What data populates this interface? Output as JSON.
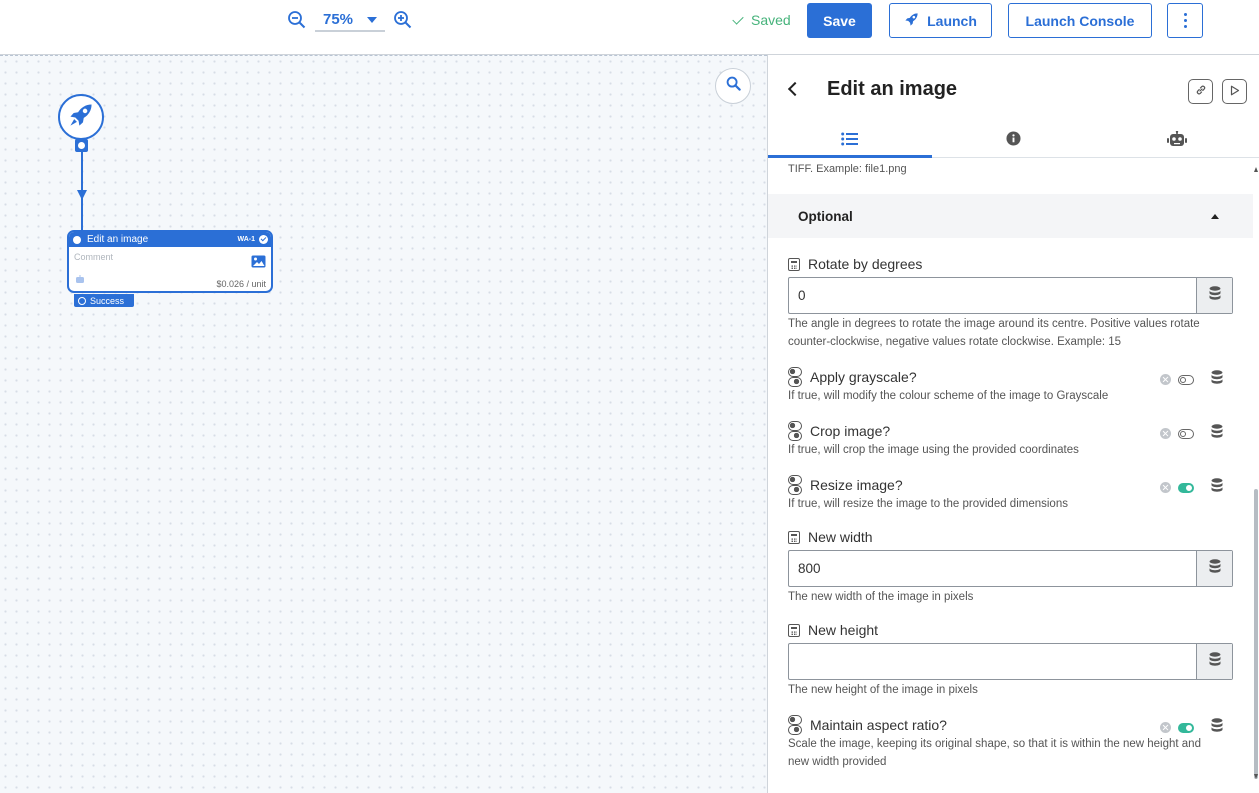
{
  "toolbar": {
    "zoom_value": "75%",
    "saved_label": "Saved",
    "save_label": "Save",
    "launch_label": "Launch",
    "launch_console_label": "Launch Console"
  },
  "canvas": {
    "task_node": {
      "title": "Edit an image",
      "id": "WA-1",
      "comment_placeholder": "Comment",
      "cost": "$0.026 / unit",
      "status": "Success"
    }
  },
  "panel": {
    "title": "Edit an image",
    "tabs": [
      {
        "icon": "list-icon",
        "active": true
      },
      {
        "icon": "info-icon",
        "active": false
      },
      {
        "icon": "robot-icon",
        "active": false
      }
    ],
    "previous_help_tail": "TIFF. Example: file1.png",
    "optional_label": "Optional",
    "fields": {
      "rotate": {
        "label": "Rotate by degrees",
        "value": "0",
        "help": "The angle in degrees to rotate the image around its centre. Positive values rotate counter-clockwise, negative values rotate clockwise. Example: 15"
      },
      "grayscale": {
        "label": "Apply grayscale?",
        "enabled": false,
        "help": "If true, will modify the colour scheme of the image to Grayscale"
      },
      "crop": {
        "label": "Crop image?",
        "enabled": false,
        "help": "If true, will crop the image using the provided coordinates"
      },
      "resize": {
        "label": "Resize image?",
        "enabled": true,
        "help": "If true, will resize the image to the provided dimensions"
      },
      "new_width": {
        "label": "New width",
        "value": "800",
        "help": "The new width of the image in pixels"
      },
      "new_height": {
        "label": "New height",
        "value": "",
        "help": "The new height of the image in pixels"
      },
      "aspect": {
        "label": "Maintain aspect ratio?",
        "enabled": true,
        "help": "Scale the image, keeping its original shape, so that it is within the new height and new width provided"
      }
    }
  },
  "colors": {
    "primary": "#2b6fd6",
    "saved_green": "#46b37b",
    "toggle_on": "#33b89a"
  }
}
